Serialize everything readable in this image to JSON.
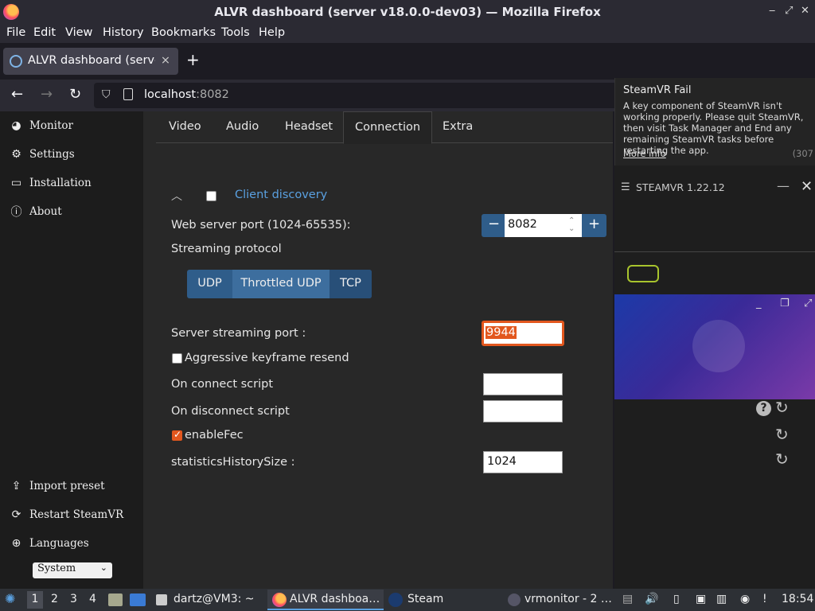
{
  "window": {
    "title": "ALVR dashboard (server v18.0.0-dev03) — Mozilla Firefox",
    "controls": [
      "‒",
      "⤢",
      "✕"
    ]
  },
  "menu": [
    "File",
    "Edit",
    "View",
    "History",
    "Bookmarks",
    "Tools",
    "Help"
  ],
  "browser_tab": {
    "label": "ALVR dashboard (server",
    "close": "×",
    "new_tab": "+"
  },
  "address": {
    "host": "localhost",
    "port": ":8082"
  },
  "sidebar": {
    "top_items": [
      {
        "label": "Monitor",
        "icon": "dashboard-icon"
      },
      {
        "label": "Settings",
        "icon": "gears-icon"
      },
      {
        "label": "Installation",
        "icon": "hdd-icon"
      },
      {
        "label": "About",
        "icon": "info-icon"
      }
    ],
    "bottom_items": [
      {
        "label": "Import preset",
        "icon": "upload-icon"
      },
      {
        "label": "Restart SteamVR",
        "icon": "refresh-icon"
      },
      {
        "label": "Languages",
        "icon": "globe-icon"
      }
    ],
    "language_value": "System"
  },
  "settings_tabs": [
    {
      "label": "Video",
      "active": false
    },
    {
      "label": "Audio",
      "active": false
    },
    {
      "label": "Headset",
      "active": false
    },
    {
      "label": "Connection",
      "active": true
    },
    {
      "label": "Extra",
      "active": false
    }
  ],
  "connection": {
    "client_discovery": "Client discovery",
    "web_server_port_label": "Web server port (1024-65535):",
    "web_server_port": "8082",
    "streaming_protocol_label": "Streaming protocol",
    "protocols": [
      "UDP",
      "Throttled UDP",
      "TCP"
    ],
    "selected_protocol": "Throttled UDP",
    "server_streaming_port_label": "Server streaming port :",
    "server_streaming_port": "9944",
    "aggressive_keyframe_label": "Aggressive keyframe resend",
    "aggressive_keyframe": false,
    "on_connect_label": "On connect script",
    "on_connect": "",
    "on_disconnect_label": "On disconnect script",
    "on_disconnect": "",
    "enable_fec_label": "enableFec",
    "enable_fec": true,
    "stats_history_label": "statisticsHistorySize :",
    "stats_history": "1024"
  },
  "notification": {
    "title": "SteamVR Fail",
    "body": "A key component of SteamVR isn't working properly. Please quit SteamVR, then visit Task Manager and End any remaining SteamVR tasks before restarting the app.",
    "link": "More info",
    "code": "(307"
  },
  "steamvr": {
    "title": "STEAMVR 1.22.12"
  },
  "taskbar": {
    "workspaces": [
      "1",
      "2",
      "3",
      "4"
    ],
    "apps": [
      {
        "label": "dartz@VM3: ~"
      },
      {
        "label": "ALVR dashboa…"
      },
      {
        "label": "Steam"
      },
      {
        "label": "vrmonitor - 2 …"
      }
    ],
    "clock": "18:54"
  },
  "colors": {
    "accent_orange": "#e2571e",
    "protocol_blue": "#2f5d8a",
    "link_blue": "#5aa0e0"
  }
}
